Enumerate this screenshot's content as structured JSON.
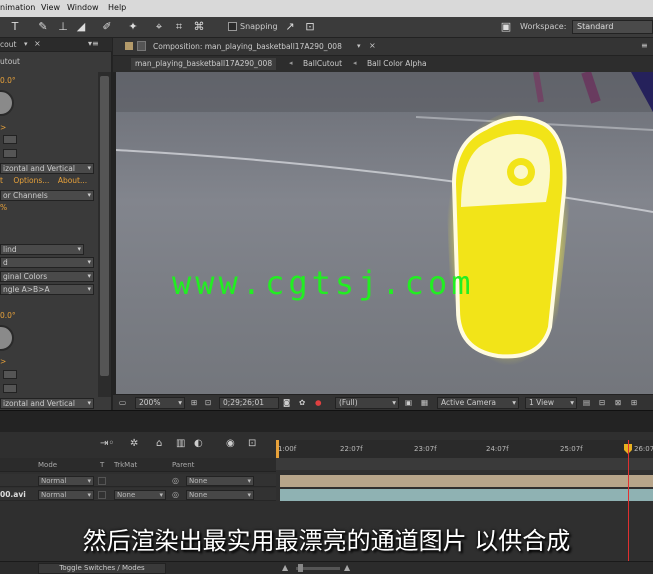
{
  "menu": {
    "items": [
      "nimation",
      "View",
      "Window",
      "Help"
    ]
  },
  "toolbar": {
    "snapping_label": "Snapping",
    "workspace_label": "Workspace:",
    "workspace_value": "Standard"
  },
  "effects_panel": {
    "tab_label": "cout",
    "effect_name": "utout",
    "angle1": "0.0°",
    "mode1": "izontal and Vertical",
    "links": [
      "t",
      "Options...",
      "About..."
    ],
    "channels": "or Channels",
    "percent": "%",
    "blend": "lind",
    "d_value": "d",
    "colors": "ginal Colors",
    "angle_order": "ngle A>B>A",
    "angle2": "0.0°",
    "mode2": "izontal and Vertical"
  },
  "composition": {
    "header_title": "Composition: man_playing_basketball17A290_008",
    "breadcrumbs": [
      "man_playing_basketball17A290_008",
      "BallCutout",
      "Ball Color Alpha"
    ]
  },
  "viewer_bar": {
    "zoom": "200%",
    "timecode": "0;29;26;01",
    "resolution": "(Full)",
    "camera": "Active Camera",
    "views": "1 View"
  },
  "watermark": "www.cgtsj.com",
  "timeline": {
    "columns": [
      "Mode",
      "T",
      "TrkMat",
      "Parent"
    ],
    "layers": [
      {
        "name": "",
        "mode": "Normal",
        "trkmat": "",
        "parent": "None"
      },
      {
        "name": "00.avi",
        "mode": "Normal",
        "trkmat": "None",
        "parent": "None"
      }
    ],
    "ruler_ticks": [
      "1:00f",
      "22:07f",
      "23:07f",
      "24:07f",
      "25:07f",
      "26:07"
    ],
    "toggle_label": "Toggle Switches / Modes"
  },
  "subtitle": "然后渲染出最实用最漂亮的通道图片 以供合成",
  "colors": {
    "accent": "#e8a23a",
    "watermark": "#22ee22",
    "ball": "#f2e418"
  }
}
